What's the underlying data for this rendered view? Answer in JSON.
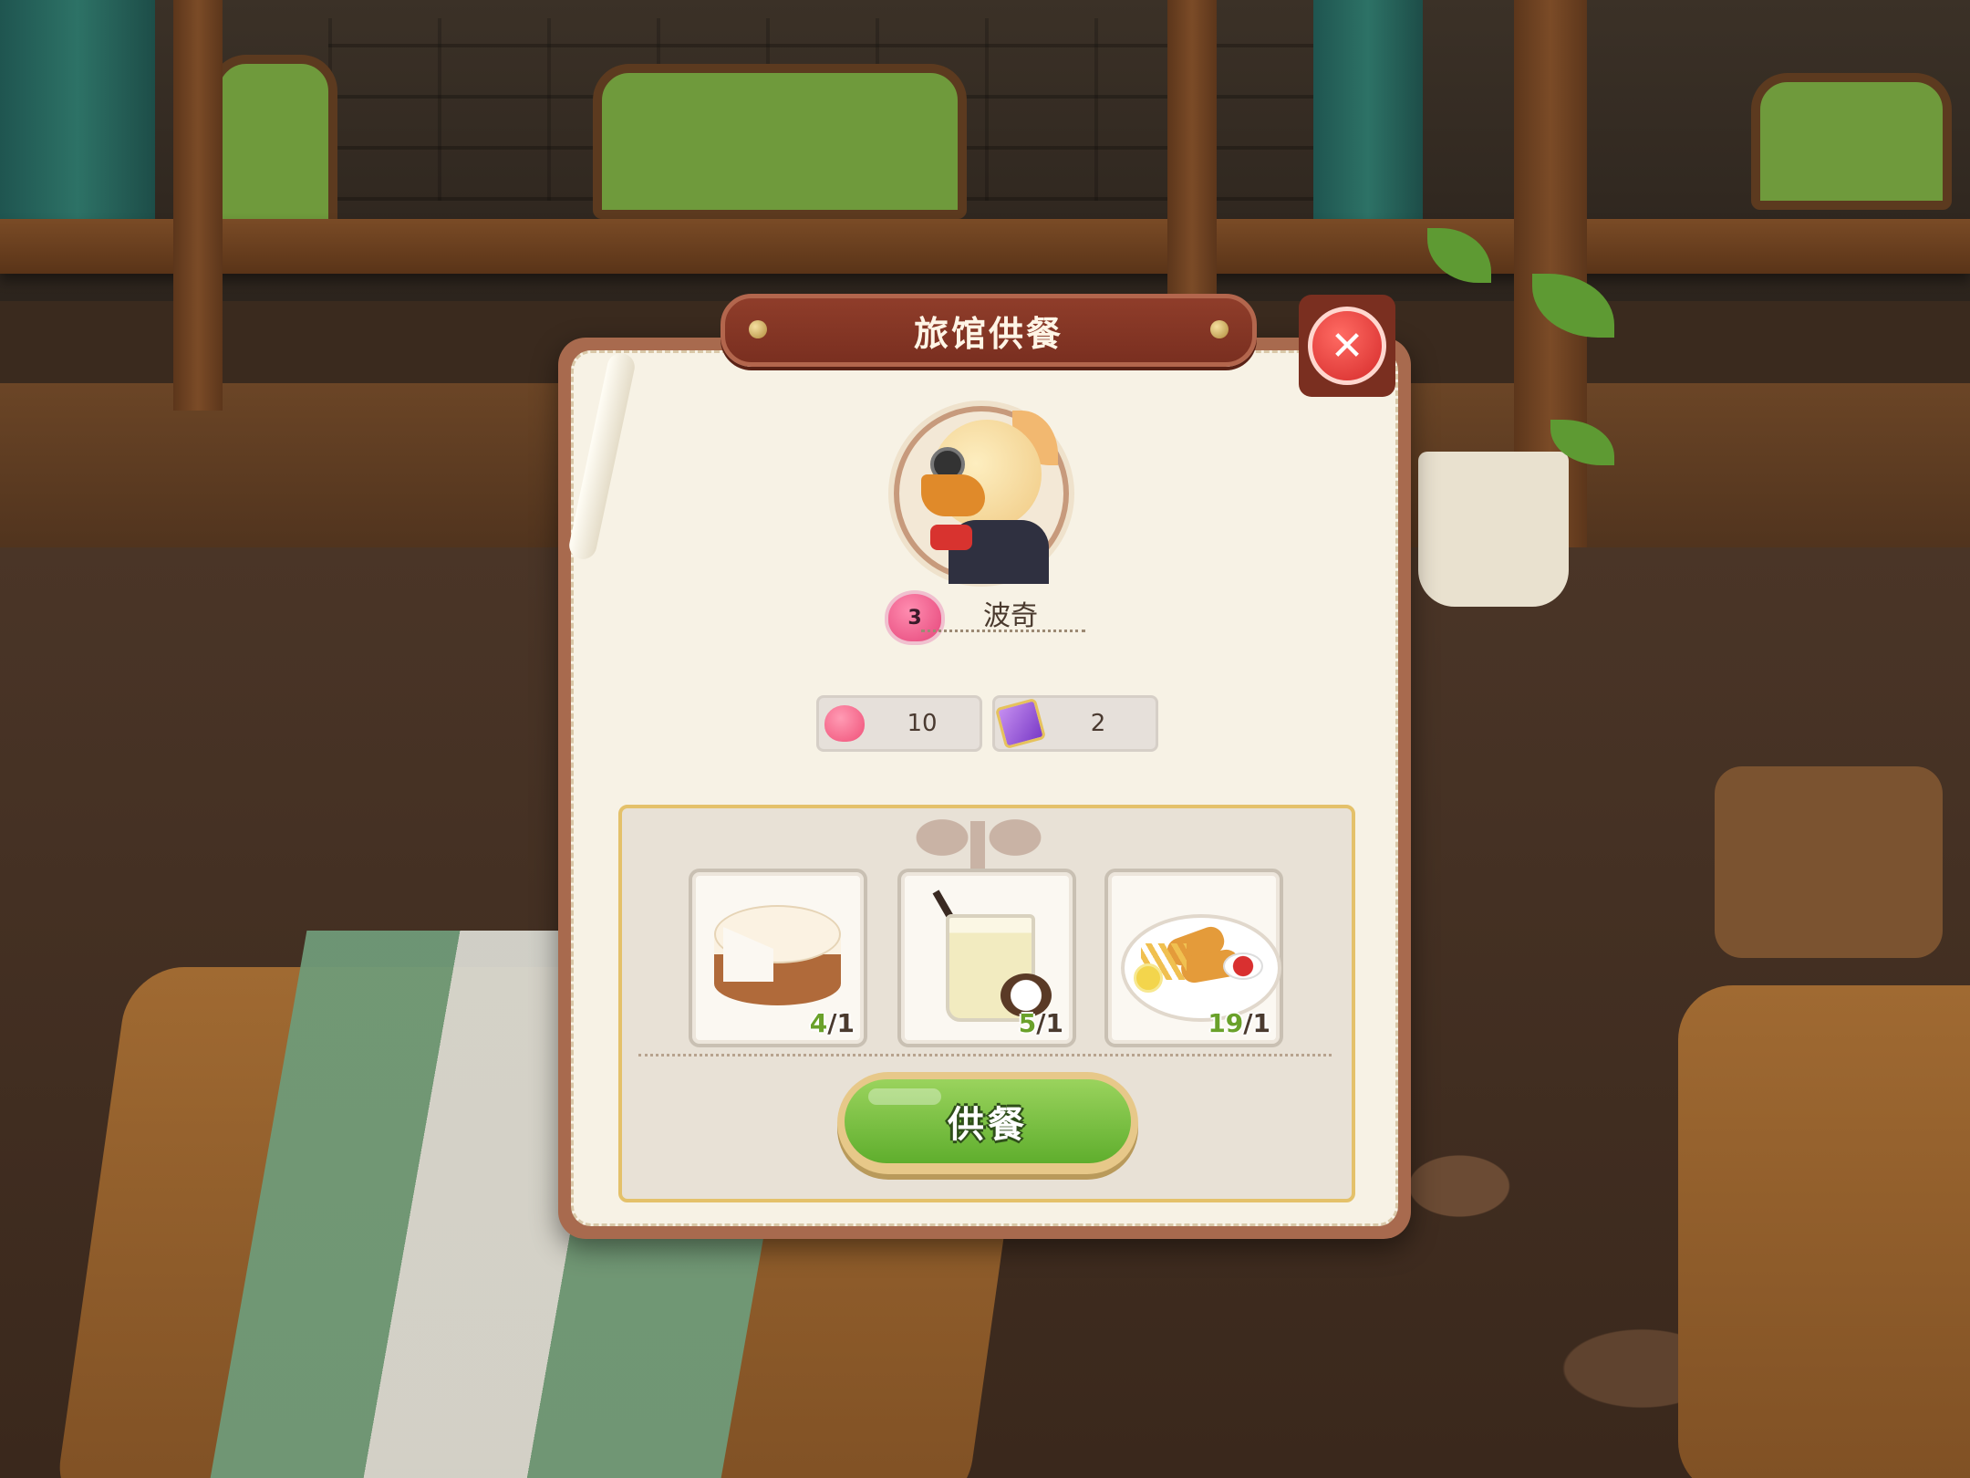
{
  "dialog": {
    "title": "旅馆供餐",
    "close_icon": "close-icon"
  },
  "guest": {
    "name": "波奇",
    "affection_level": "3",
    "portrait_icon": "bird-guest-portrait"
  },
  "rewards": [
    {
      "icon": "heart-icon",
      "value": "10"
    },
    {
      "icon": "ticket-icon",
      "value": "2"
    }
  ],
  "meals": [
    {
      "name": "cake",
      "icon": "cream-cake-icon",
      "have": "4",
      "need": "/1"
    },
    {
      "name": "coconut-drink",
      "icon": "coconut-drink-icon",
      "have": "5",
      "need": "/1"
    },
    {
      "name": "fish-and-chips",
      "icon": "fish-and-chips-icon",
      "have": "19",
      "need": "/1"
    }
  ],
  "serve_button": {
    "label": "供餐",
    "color": "#5fae2d"
  },
  "colors": {
    "title_bar": "#8f3d2a",
    "panel_border": "#e4c16a",
    "close_button": "#d52a2a"
  }
}
